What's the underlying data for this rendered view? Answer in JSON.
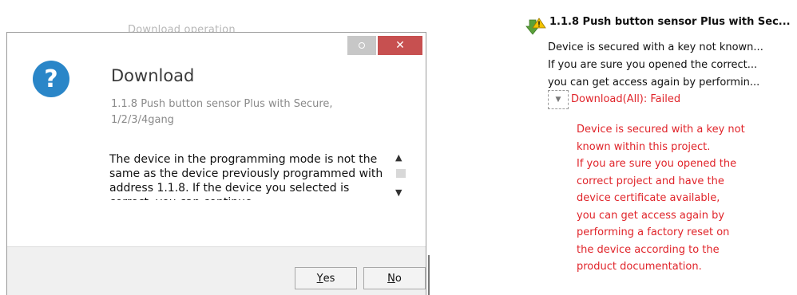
{
  "background_text": "Download operation",
  "dialog": {
    "title": "Download",
    "subtitle": "1.1.8 Push button sensor Plus with Secure, 1/2/3/4gang",
    "message": "The device in the programming mode is not the same as the device previously programmed with address 1.1.8. If the device you selected is correct, you can continue.",
    "yes_label": "Yes",
    "yes_mnemonic": "Y",
    "yes_rest": "es",
    "no_label": "No",
    "no_mnemonic": "N",
    "no_rest": "o",
    "close_glyph": "✕",
    "icon_glyph": "?"
  },
  "tree": {
    "title": "1.1.8 Push button sensor Plus with Sec...",
    "lines": [
      "Device is secured with a key not known...",
      "If you are sure you opened the correct...",
      "you can get access again by performin..."
    ],
    "toggle_glyph": "▼",
    "status": "Download(All): Failed",
    "detail_lines": [
      "Device is secured with a key not",
      "known within this project.",
      "If you are sure you opened the",
      "correct project and have the",
      "device certificate available,",
      "you can get access again by",
      "performing a factory reset on",
      "the device according to the",
      "product documentation."
    ]
  },
  "colors": {
    "error": "#e0242a",
    "info_icon": "#2a86c8",
    "close_button": "#c75050",
    "download_arrow": "#5aa13a",
    "warning": "#f2c200"
  },
  "icons": {
    "dialog": "question-icon",
    "tree": "download-warning-icon"
  }
}
